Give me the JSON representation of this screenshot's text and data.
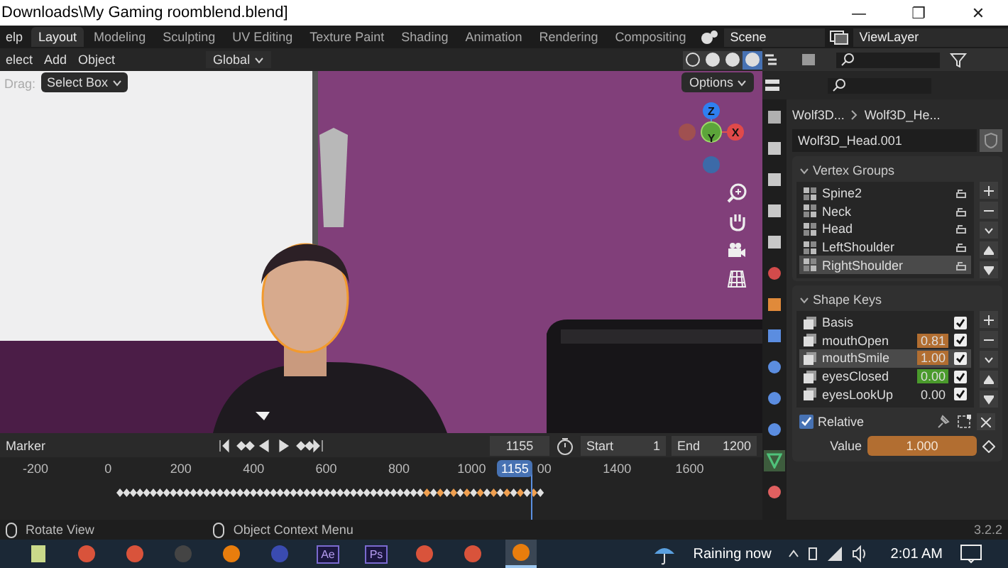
{
  "window": {
    "title": "Downloads\\My Gaming roomblend.blend]",
    "controls": [
      "—",
      "❐",
      "✕"
    ]
  },
  "menus": [
    "elp"
  ],
  "workspace_tabs": [
    {
      "label": "Layout",
      "selected": true
    },
    {
      "label": "Modeling",
      "selected": false
    },
    {
      "label": "Sculpting",
      "selected": false
    },
    {
      "label": "UV Editing",
      "selected": false
    },
    {
      "label": "Texture Paint",
      "selected": false
    },
    {
      "label": "Shading",
      "selected": false
    },
    {
      "label": "Animation",
      "selected": false
    },
    {
      "label": "Rendering",
      "selected": false
    },
    {
      "label": "Compositing",
      "selected": false
    }
  ],
  "scene": "Scene",
  "view_layer": "ViewLayer",
  "viewport_header": {
    "menus": [
      "elect",
      "Add",
      "Object"
    ],
    "orientation": "Global",
    "shading": [
      {
        "selected": false
      },
      {
        "selected": false
      },
      {
        "selected": false
      },
      {
        "selected": true
      }
    ]
  },
  "tool_settings": {
    "drag_label": "Drag:",
    "drag_value": "Select Box",
    "options": "Options"
  },
  "gizmo": {
    "axes": [
      "Z",
      "Y",
      "X"
    ]
  },
  "properties": {
    "tabs": [
      {
        "selected": false
      },
      {
        "selected": false
      },
      {
        "selected": false
      },
      {
        "selected": false
      },
      {
        "selected": false
      },
      {
        "selected": false
      },
      {
        "selected": false
      },
      {
        "selected": false
      },
      {
        "selected": false
      },
      {
        "selected": false
      },
      {
        "selected": false
      },
      {
        "selected": true
      },
      {
        "selected": false
      }
    ],
    "breadcrumb": [
      "Wolf3D...",
      "Wolf3D_He..."
    ],
    "mesh": "Wolf3D_Head.001",
    "vertex_groups": {
      "title": "Vertex Groups",
      "items": [
        {
          "name": "Spine2",
          "selected": false
        },
        {
          "name": "Neck",
          "selected": false
        },
        {
          "name": "Head",
          "selected": false
        },
        {
          "name": "LeftShoulder",
          "selected": false
        },
        {
          "name": "RightShoulder",
          "selected": true
        }
      ]
    },
    "shape_keys": {
      "title": "Shape Keys",
      "items": [
        {
          "name": "Basis",
          "checked": true,
          "selected": false
        },
        {
          "name": "mouthOpen",
          "value": "0.81",
          "kind": "keyed",
          "checked": true,
          "selected": false
        },
        {
          "name": "mouthSmile",
          "value": "1.00",
          "kind": "keyed",
          "checked": true,
          "selected": true
        },
        {
          "name": "eyesClosed",
          "value": "0.00",
          "kind": "animated",
          "checked": true,
          "selected": false
        },
        {
          "name": "eyesLookUp",
          "value": "0.00",
          "kind": "plain",
          "checked": true,
          "selected": false
        }
      ]
    },
    "relative": {
      "label": "Relative",
      "checked": true
    },
    "value": {
      "label": "Value",
      "value": "1.000",
      "kind": "keyed"
    }
  },
  "timeline": {
    "marker": "Marker",
    "current_frame": "1155",
    "start_label": "Start",
    "start": "1",
    "end_label": "End",
    "end": "1200",
    "ticks": [
      "-200",
      "0",
      "200",
      "400",
      "600",
      "800",
      "1000",
      "00",
      "1400",
      "1600"
    ],
    "playhead": "1155"
  },
  "status_bar": {
    "hints": [
      "Rotate View",
      "Object Context Menu"
    ],
    "version": "3.2.2"
  },
  "taskbar": {
    "apps": [
      {
        "kind": "notes",
        "selected": false
      },
      {
        "kind": "browser",
        "selected": false
      },
      {
        "kind": "browser",
        "selected": false
      },
      {
        "kind": "recorder",
        "selected": false
      },
      {
        "kind": "blender",
        "selected": false
      },
      {
        "kind": "bag",
        "selected": false
      },
      {
        "kind": "letters",
        "label": "Ae",
        "selected": false
      },
      {
        "kind": "letters",
        "label": "Ps",
        "selected": false
      },
      {
        "kind": "browser",
        "selected": false
      },
      {
        "kind": "browser",
        "selected": false
      },
      {
        "kind": "blender",
        "selected": true
      }
    ],
    "weather": "Raining now",
    "clock": "2:01 AM"
  }
}
